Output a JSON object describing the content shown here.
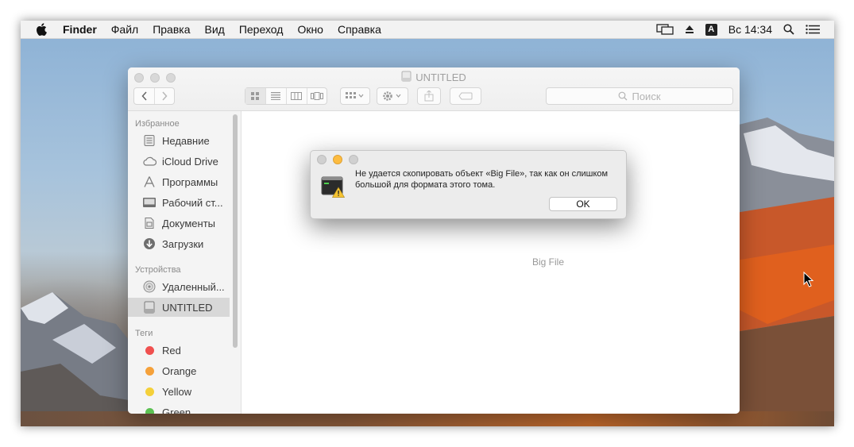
{
  "menubar": {
    "app_name": "Finder",
    "items": [
      "Файл",
      "Правка",
      "Вид",
      "Переход",
      "Окно",
      "Справка"
    ],
    "input_source": "A",
    "clock": "Вс 14:34"
  },
  "window": {
    "title": "UNTITLED",
    "search_placeholder": "Поиск"
  },
  "sidebar": {
    "favorites_title": "Избранное",
    "favorites": [
      {
        "label": "Недавние",
        "icon": "recents-icon"
      },
      {
        "label": "iCloud Drive",
        "icon": "icloud-icon"
      },
      {
        "label": "Программы",
        "icon": "applications-icon"
      },
      {
        "label": "Рабочий ст...",
        "icon": "desktop-icon"
      },
      {
        "label": "Документы",
        "icon": "documents-icon"
      },
      {
        "label": "Загрузки",
        "icon": "downloads-icon"
      }
    ],
    "devices_title": "Устройства",
    "devices": [
      {
        "label": "Удаленный...",
        "icon": "remote-disc-icon"
      },
      {
        "label": "UNTITLED",
        "icon": "disk-icon",
        "selected": true
      }
    ],
    "tags_title": "Теги",
    "tags": [
      {
        "label": "Red",
        "color": "#f0504f"
      },
      {
        "label": "Orange",
        "color": "#f5a13a"
      },
      {
        "label": "Yellow",
        "color": "#f4d03a"
      },
      {
        "label": "Green",
        "color": "#5cc152"
      }
    ]
  },
  "content": {
    "file_name": "Big File"
  },
  "alert": {
    "message": "Не удается скопировать объект «Big File», так как он слишком большой для формата этого тома.",
    "ok_label": "OK"
  },
  "colors": {
    "accent_close": "#fc605b",
    "accent_minimize": "#fdbc40",
    "sidebar_selected": "#d8d8d8"
  }
}
